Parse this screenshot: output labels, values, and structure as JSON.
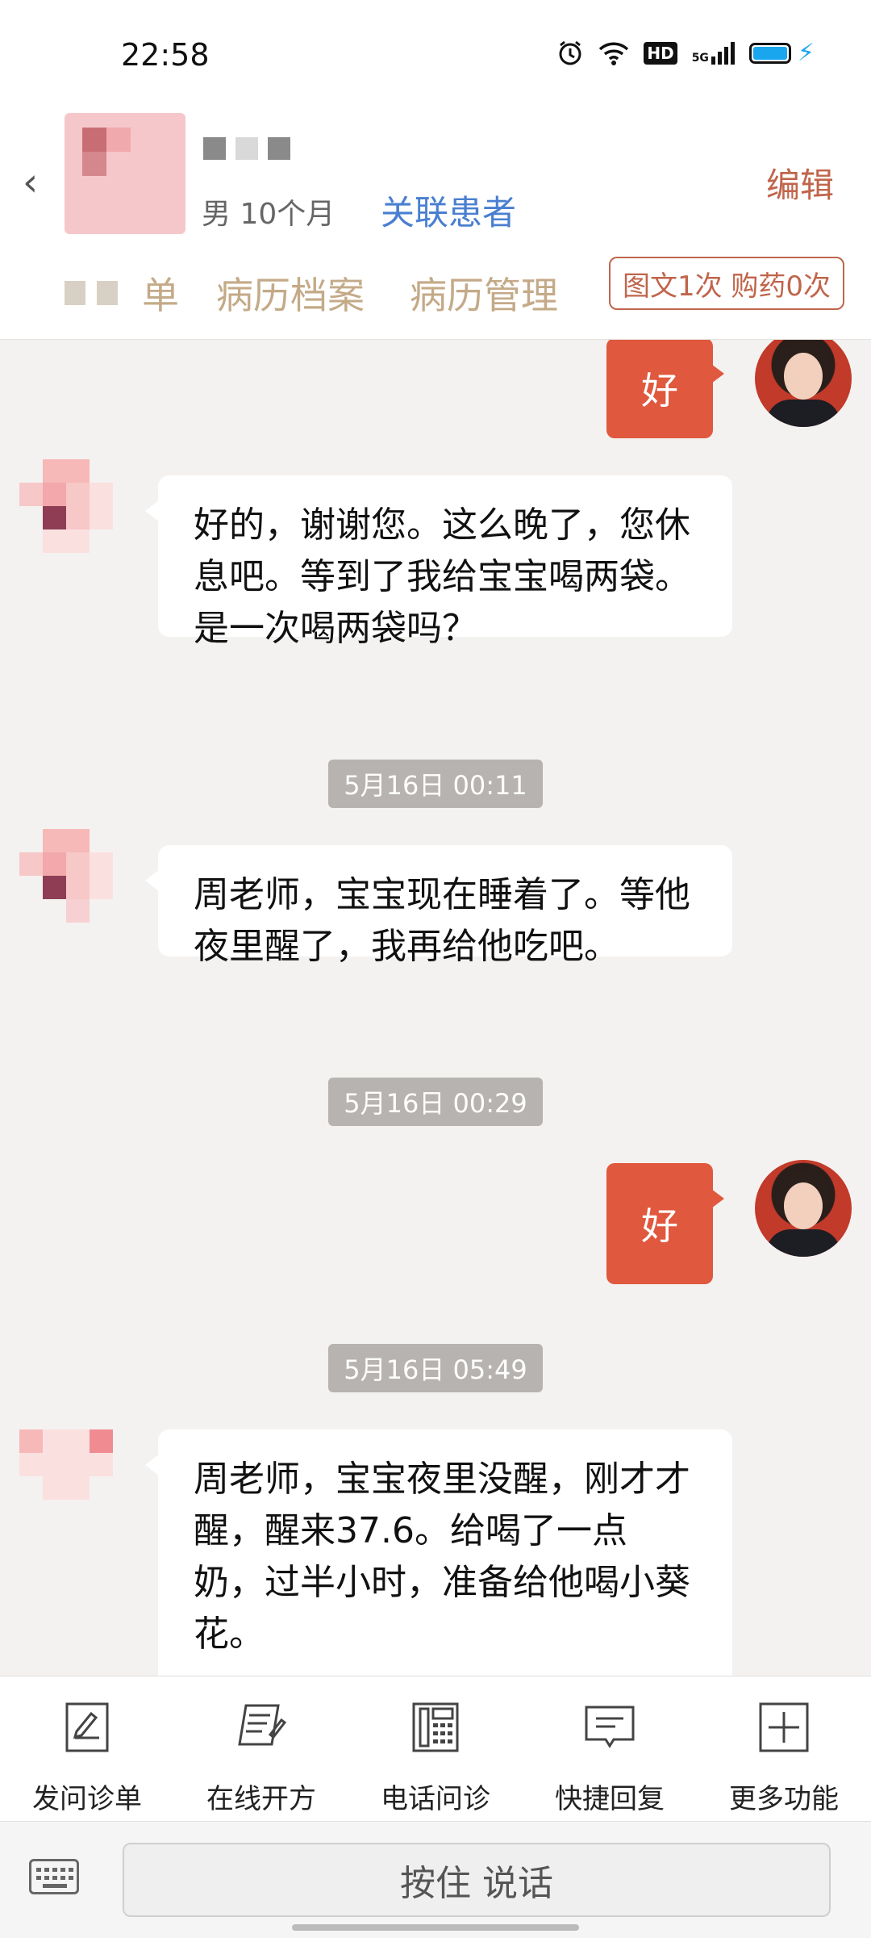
{
  "status_bar": {
    "time": "22:58",
    "network": "5G",
    "hd": "HD"
  },
  "header": {
    "meta": "男 10个月",
    "link": "关联患者",
    "edit": "编辑",
    "tabs": [
      "单",
      "病历档案",
      "病历管理"
    ],
    "badge": "图文1次 购药0次"
  },
  "messages": [
    {
      "side": "right",
      "text": "好"
    },
    {
      "side": "left",
      "text": "好的，谢谢您。这么晚了，您休息吧。等到了我给宝宝喝两袋。是一次喝两袋吗？"
    },
    {
      "type": "time",
      "text": "5月16日 00:11"
    },
    {
      "side": "left",
      "text": "周老师，宝宝现在睡着了。等他夜里醒了，我再给他吃吧。"
    },
    {
      "type": "time",
      "text": "5月16日 00:29"
    },
    {
      "side": "right",
      "text": "好"
    },
    {
      "type": "time",
      "text": "5月16日 05:49"
    },
    {
      "side": "left",
      "text": "周老师，宝宝夜里没醒，刚才才醒，醒来37.6。给喝了一点奶，过半小时，准备给他喝小葵花。"
    }
  ],
  "toolbar": [
    {
      "label": "发问诊单",
      "icon": "form-pen-icon"
    },
    {
      "label": "在线开方",
      "icon": "prescription-icon"
    },
    {
      "label": "电话问诊",
      "icon": "phone-icon"
    },
    {
      "label": "快捷回复",
      "icon": "quick-reply-icon"
    },
    {
      "label": "更多功能",
      "icon": "plus-icon"
    }
  ],
  "input": {
    "talk_label": "按住 说话"
  },
  "colors": {
    "accent": "#e0583e",
    "link": "#4a7fd0",
    "tab": "#c4aa88",
    "edit": "#c0654b"
  }
}
